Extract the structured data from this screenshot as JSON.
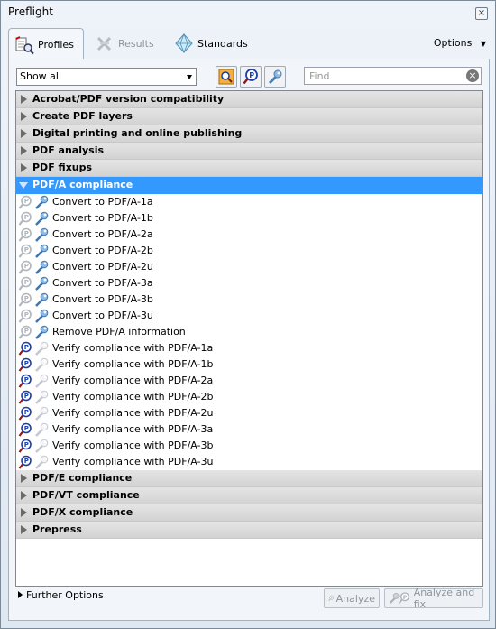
{
  "window": {
    "title": "Preflight"
  },
  "tabs": [
    {
      "label": "Profiles",
      "icon": "profiles-icon",
      "active": true
    },
    {
      "label": "Results",
      "icon": "results-icon",
      "active": false
    },
    {
      "label": "Standards",
      "icon": "standards-icon",
      "active": false
    }
  ],
  "options_label": "Options",
  "filter": {
    "selected": "Show all"
  },
  "search": {
    "placeholder": "Find"
  },
  "toolbar_icons": [
    "fix-profile-icon",
    "check-icon",
    "fixup-wrench-icon"
  ],
  "tree": {
    "categories_before": [
      "Acrobat/PDF version compatibility",
      "Create PDF layers",
      "Digital printing and online publishing",
      "PDF analysis",
      "PDF fixups"
    ],
    "expanded": {
      "label": "PDF/A compliance",
      "items": [
        {
          "label": "Convert to PDF/A-1a",
          "kind": "fixup"
        },
        {
          "label": "Convert to PDF/A-1b",
          "kind": "fixup"
        },
        {
          "label": "Convert to PDF/A-2a",
          "kind": "fixup"
        },
        {
          "label": "Convert to PDF/A-2b",
          "kind": "fixup"
        },
        {
          "label": "Convert to PDF/A-2u",
          "kind": "fixup"
        },
        {
          "label": "Convert to PDF/A-3a",
          "kind": "fixup"
        },
        {
          "label": "Convert to PDF/A-3b",
          "kind": "fixup"
        },
        {
          "label": "Convert to PDF/A-3u",
          "kind": "fixup"
        },
        {
          "label": "Remove PDF/A information",
          "kind": "fixup"
        },
        {
          "label": "Verify compliance with PDF/A-1a",
          "kind": "check"
        },
        {
          "label": "Verify compliance with PDF/A-1b",
          "kind": "check"
        },
        {
          "label": "Verify compliance with PDF/A-2a",
          "kind": "check"
        },
        {
          "label": "Verify compliance with PDF/A-2b",
          "kind": "check"
        },
        {
          "label": "Verify compliance with PDF/A-2u",
          "kind": "check"
        },
        {
          "label": "Verify compliance with PDF/A-3a",
          "kind": "check"
        },
        {
          "label": "Verify compliance with PDF/A-3b",
          "kind": "check"
        },
        {
          "label": "Verify compliance with PDF/A-3u",
          "kind": "check"
        }
      ]
    },
    "categories_after": [
      "PDF/E compliance",
      "PDF/VT compliance",
      "PDF/X compliance",
      "Prepress"
    ]
  },
  "further_options": "Further Options",
  "buttons": {
    "analyze": "Analyze",
    "analyze_fix": "Analyze and fix"
  },
  "colors": {
    "selection": "#3399ff",
    "check_blue": "#1b3fa8",
    "panel": "#f2f5f9"
  }
}
